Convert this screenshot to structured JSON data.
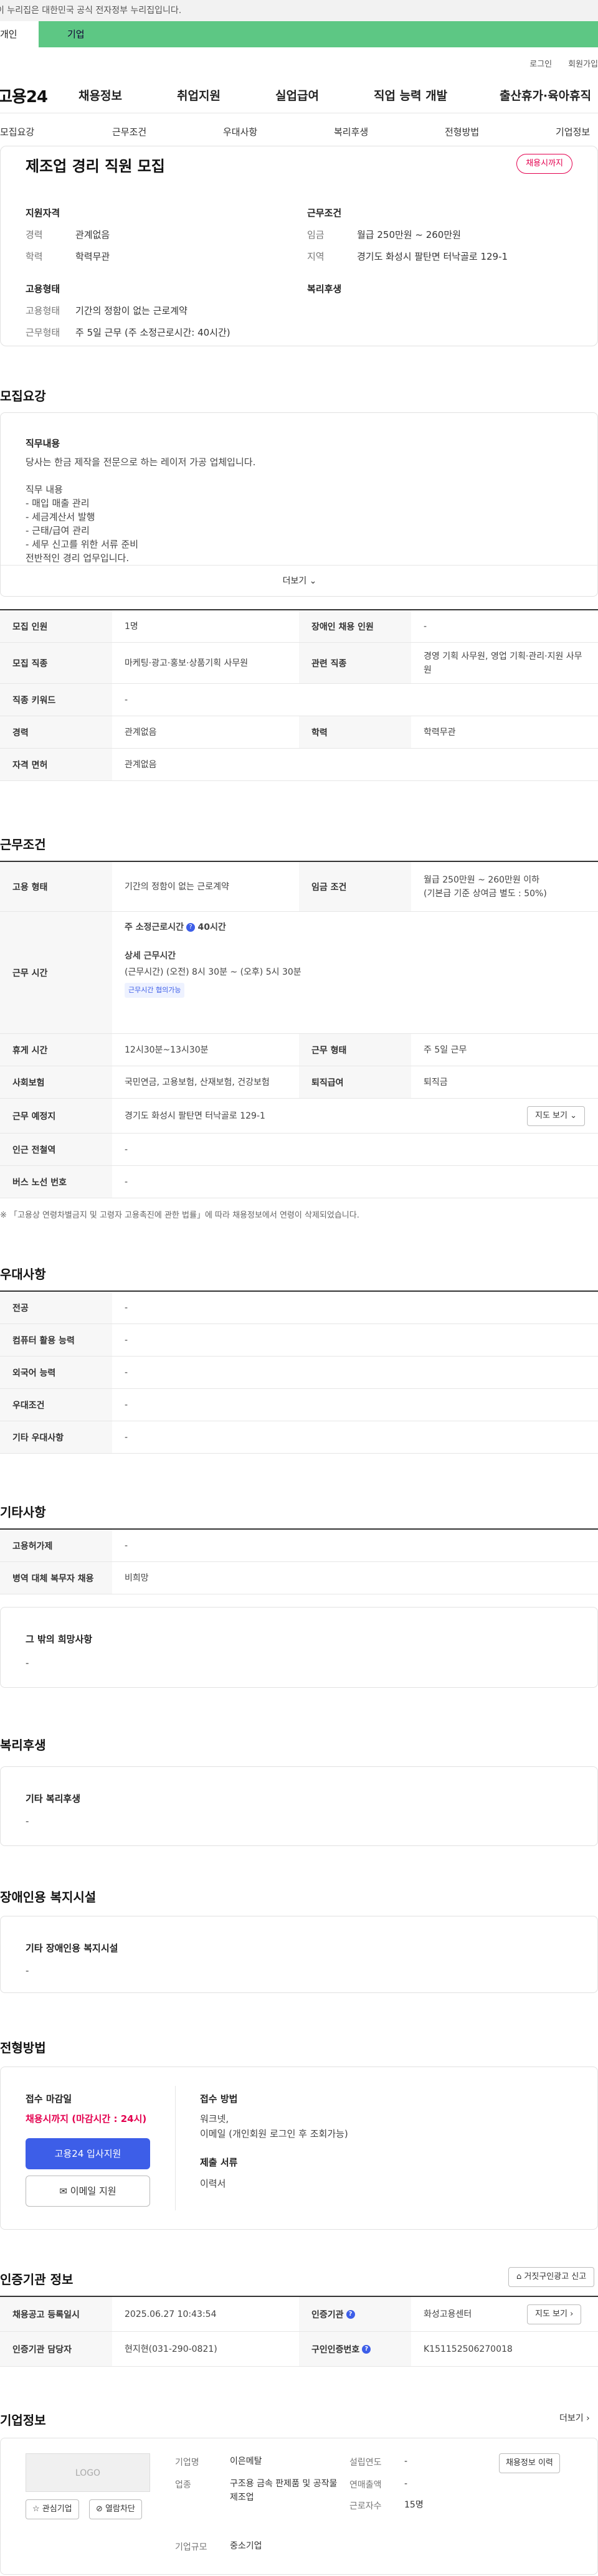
{
  "gov_banner": "이 누리집은 대한민국 공식 전자정부 누리집입니다.",
  "user_tabs": {
    "person": "개인",
    "corp": "기업"
  },
  "util_links": [
    "로그인",
    "회원가입"
  ],
  "logo": "고용24",
  "gnb": [
    "채용정보",
    "취업지원",
    "실업급여",
    "직업 능력 개발",
    "출산휴가·육아휴직"
  ],
  "subnav": [
    "모집요강",
    "근무조건",
    "우대사항",
    "복리후생",
    "전형방법",
    "기업정보"
  ],
  "summary": {
    "title": "제조업 경리 직원 모집",
    "status": "채용시까지",
    "qual_head": "지원자격",
    "career_k": "경력",
    "career_v": "관계없음",
    "edu_k": "학력",
    "edu_v": "학력무관",
    "cond_head": "근무조건",
    "wage_k": "임금",
    "wage_v": "월급 250만원 ~ 260만원",
    "region_k": "지역",
    "region_v": "경기도 화성시 팔탄면 터낙골로 129-1",
    "emp_head": "고용형태",
    "emptype_k": "고용형태",
    "emptype_v": "기간의 정함이 없는 근로계약",
    "worktype_k": "근무형태",
    "worktype_v": "주 5일 근무 (주 소정근로시간: 40시간)",
    "welfare_head": "복리후생"
  },
  "recruit": {
    "title": "모집요강",
    "job_label": "직무내용",
    "job_text": "당사는 한금 제작을 전문으로 하는 레이저 가공 업체입니다.\n\n직무 내용\n- 매입 매출 관리\n- 세금계산서 발행\n- 근태/급여 관리\n- 세무 신고를 위한 서류 준비\n전반적인 경리 업무입니다.",
    "more": "더보기",
    "rows": [
      {
        "k1": "모집 인원",
        "v1": "1명",
        "k2": "장애인 채용 인원",
        "v2": "-"
      },
      {
        "k1": "모집 직종",
        "v1": "마케팅·광고·홍보·상품기획 사무원",
        "k2": "관련 직종",
        "v2": "경영 기획 사무원, 영업 기획·관리·지원 사무원"
      },
      {
        "k1": "직종 키워드",
        "v1": "-"
      },
      {
        "k1": "경력",
        "v1": "관계없음",
        "k2": "학력",
        "v2": "학력무관"
      },
      {
        "k1": "자격 면허",
        "v1": "관계없음"
      }
    ]
  },
  "conditions": {
    "title": "근무조건",
    "emp_k": "고용 형태",
    "emp_v": "기간의 정함이 없는 근로계약",
    "wage_k": "임금 조건",
    "wage_v1": "월급 250만원 ~ 260만원 이하",
    "wage_v2": "(기본급 기준 상여금 별도 : 50%)",
    "hours_k": "근무 시간",
    "hours_weekly": "주 소정근로시간",
    "hours_weekly_v": "40시간",
    "hours_detail_head": "상세 근무시간",
    "hours_detail": "(근무시간) (오전) 8시 30분 ~ (오후) 5시 30분",
    "hours_badge": "근무시간 협의가능",
    "break_k": "휴게 시간",
    "break_v": "12시30분~13시30분",
    "shift_k": "근무 형태",
    "shift_v": "주 5일 근무",
    "ins_k": "사회보험",
    "ins_v": "국민연금, 고용보험, 산재보험, 건강보험",
    "sev_k": "퇴직급여",
    "sev_v": "퇴직금",
    "place_k": "근무 예정지",
    "place_v": "경기도 화성시 팔탄면 터낙골로 129-1",
    "map_btn": "지도 보기",
    "subway_k": "인근 전철역",
    "subway_v": "-",
    "bus_k": "버스 노선 번호",
    "bus_v": "-",
    "note": "※ 「고용상 연령차별금지 및 고령자 고용촉진에 관한 법률」에 따라 채용정보에서 연령이 삭제되었습니다."
  },
  "preferences": {
    "title": "우대사항",
    "rows": [
      {
        "k": "전공",
        "v": "-"
      },
      {
        "k": "컴퓨터 활용 능력",
        "v": "-"
      },
      {
        "k": "외국어 능력",
        "v": "-"
      },
      {
        "k": "우대조건",
        "v": "-"
      },
      {
        "k": "기타 우대사항",
        "v": "-"
      }
    ]
  },
  "etc": {
    "title": "기타사항",
    "rows": [
      {
        "k": "고용허가제",
        "v": "-"
      },
      {
        "k": "병역 대체 복무자 채용",
        "v": "비희망"
      }
    ],
    "other_label": "그 밖의 희망사항",
    "other_value": "-"
  },
  "welfare": {
    "title": "복리후생",
    "label": "기타 복리후생",
    "value": "-"
  },
  "disability": {
    "title": "장애인용 복지시설",
    "label": "기타 장애인용 복지시설",
    "value": "-"
  },
  "selection": {
    "title": "전형방법",
    "deadline_label": "접수 마감일",
    "deadline_value": "채용시까지 (마감시간 : 24시)",
    "apply_btn": "고용24 입사지원",
    "email_btn": "이메일 지원",
    "method_label": "접수 방법",
    "method_value1": "워크넷,",
    "method_value2": "이메일 (개인회원 로그인 후 조회가능)",
    "docs_label": "제출 서류",
    "docs_value": "이력서"
  },
  "cert": {
    "title": "인증기관 정보",
    "report_btn": "거짓구인광고 신고",
    "reg_k": "채용공고 등록일시",
    "reg_v": "2025.06.27 10:43:54",
    "org_k": "인증기관",
    "org_v": "화성고용센터",
    "map_btn": "지도 보기",
    "mgr_k": "인증기관 담당자",
    "mgr_v": "현지현(031-290-0821)",
    "id_k": "구인인증번호",
    "id_v": "K151152506270018"
  },
  "company": {
    "title": "기업정보",
    "more": "더보기",
    "logo": "LOGO",
    "fav_btn": "관심기업",
    "follow_btn": "열람차단",
    "name_k": "기업명",
    "name_v": "이은메탈",
    "est_k": "설립연도",
    "est_v": "-",
    "ind_k": "업종",
    "ind_v": "구조용 금속 판제품 및 공작물 제조업",
    "sales_k": "연매출액",
    "sales_v": "-",
    "emp_k": "근로자수",
    "emp_v": "15명",
    "size_k": "기업규모",
    "size_v": "중소기업",
    "history_btn": "채용정보 이력"
  }
}
